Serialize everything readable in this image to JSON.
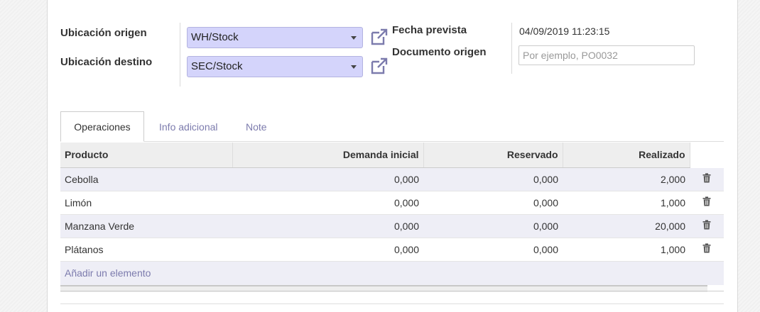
{
  "form": {
    "source_location_label": "Ubicación origen",
    "dest_location_label": "Ubicación destino",
    "source_location_value": "WH/Stock",
    "dest_location_value": "SEC/Stock",
    "scheduled_date_label": "Fecha prevista",
    "source_doc_label": "Documento origen",
    "scheduled_date_value": "04/09/2019 11:23:15",
    "source_doc_placeholder": "Por ejemplo, PO0032"
  },
  "tabs": [
    {
      "label": "Operaciones",
      "active": true
    },
    {
      "label": "Info adicional",
      "active": false
    },
    {
      "label": "Note",
      "active": false
    }
  ],
  "table": {
    "headers": [
      "Producto",
      "Demanda inicial",
      "Reservado",
      "Realizado"
    ],
    "rows": [
      {
        "product": "Cebolla",
        "demand": "0,000",
        "reserved": "0,000",
        "done": "2,000"
      },
      {
        "product": "Limón",
        "demand": "0,000",
        "reserved": "0,000",
        "done": "1,000"
      },
      {
        "product": "Manzana Verde",
        "demand": "0,000",
        "reserved": "0,000",
        "done": "20,000"
      },
      {
        "product": "Plátanos",
        "demand": "0,000",
        "reserved": "0,000",
        "done": "1,000"
      }
    ],
    "add_line_label": "Añadir un elemento"
  },
  "icons": {
    "external_link": "external-link-icon",
    "delete": "trash-icon",
    "dropdown": "caret-down-icon"
  },
  "colors": {
    "required_field_bg": "#d4d4fb",
    "link": "#7c7bad",
    "icon": "#7c7bad"
  }
}
